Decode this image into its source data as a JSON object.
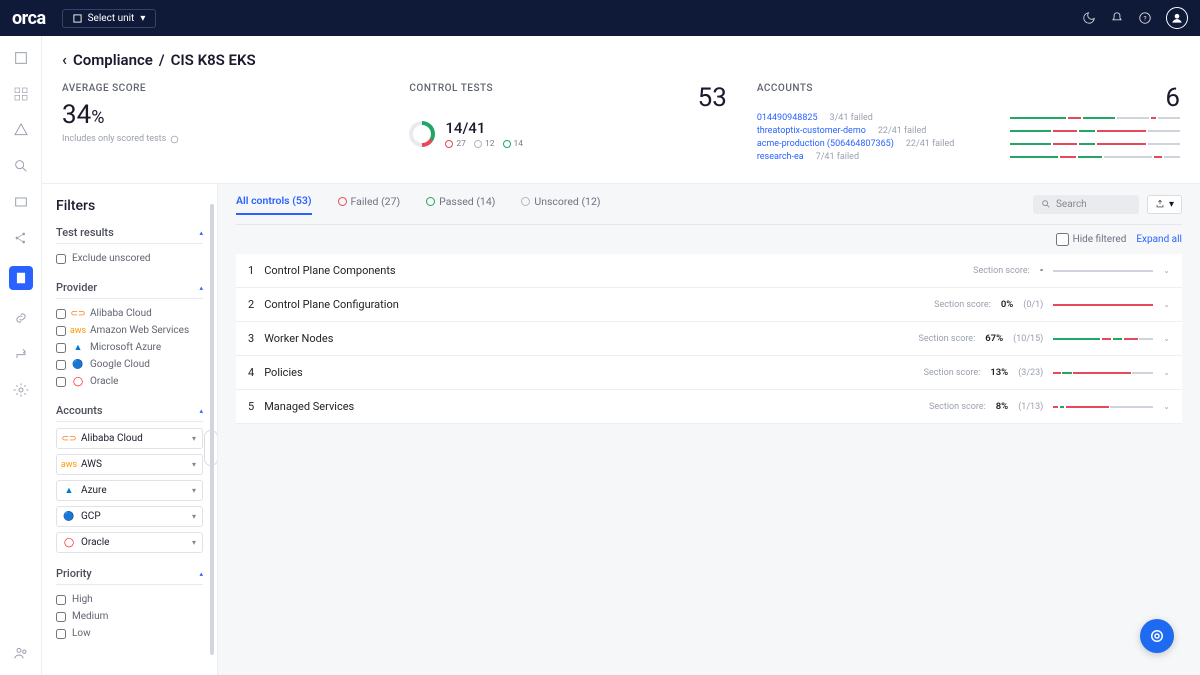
{
  "topbar": {
    "logo": "orca",
    "select_unit": "Select unit"
  },
  "breadcrumb": {
    "parent": "Compliance",
    "current": "CIS K8S EKS"
  },
  "avg_score": {
    "title": "AVERAGE SCORE",
    "value": "34",
    "pct": "%",
    "note": "Includes only scored tests"
  },
  "control_tests": {
    "title": "CONTROL TESTS",
    "count": "53",
    "ratio": "14/41",
    "failed": "27",
    "unscored": "12",
    "passed": "14"
  },
  "accounts": {
    "title": "ACCOUNTS",
    "count": "6",
    "rows": [
      {
        "name": "014490948825",
        "stat": "3/41 failed"
      },
      {
        "name": "threatoptix-customer-demo",
        "stat": "22/41 failed"
      },
      {
        "name": "acme-production (506464807365)",
        "stat": "22/41 failed"
      },
      {
        "name": "research-ea",
        "stat": "7/41 failed"
      }
    ]
  },
  "filters": {
    "title": "Filters",
    "test_results": {
      "head": "Test results",
      "exclude": "Exclude unscored"
    },
    "provider": {
      "head": "Provider",
      "items": [
        "Alibaba Cloud",
        "Amazon Web Services",
        "Microsoft Azure",
        "Google Cloud",
        "Oracle"
      ]
    },
    "accounts_sec": {
      "head": "Accounts",
      "items": [
        "Alibaba Cloud",
        "AWS",
        "Azure",
        "GCP",
        "Oracle"
      ]
    },
    "priority": {
      "head": "Priority",
      "items": [
        "High",
        "Medium",
        "Low"
      ]
    }
  },
  "tabs": {
    "all": "All controls (53)",
    "failed": "Failed (27)",
    "passed": "Passed (14)",
    "unscored": "Unscored (12)"
  },
  "search": {
    "placeholder": "Search"
  },
  "actions": {
    "hide": "Hide filtered",
    "expand": "Expand all"
  },
  "sections": [
    {
      "num": "1",
      "name": "Control Plane Components",
      "score_label": "Section score:",
      "val": "-",
      "ratio": ""
    },
    {
      "num": "2",
      "name": "Control Plane Configuration",
      "score_label": "Section score:",
      "val": "0%",
      "ratio": "(0/1)"
    },
    {
      "num": "3",
      "name": "Worker Nodes",
      "score_label": "Section score:",
      "val": "67%",
      "ratio": "(10/15)"
    },
    {
      "num": "4",
      "name": "Policies",
      "score_label": "Section score:",
      "val": "13%",
      "ratio": "(3/23)"
    },
    {
      "num": "5",
      "name": "Managed Services",
      "score_label": "Section score:",
      "val": "8%",
      "ratio": "(1/13)"
    }
  ]
}
